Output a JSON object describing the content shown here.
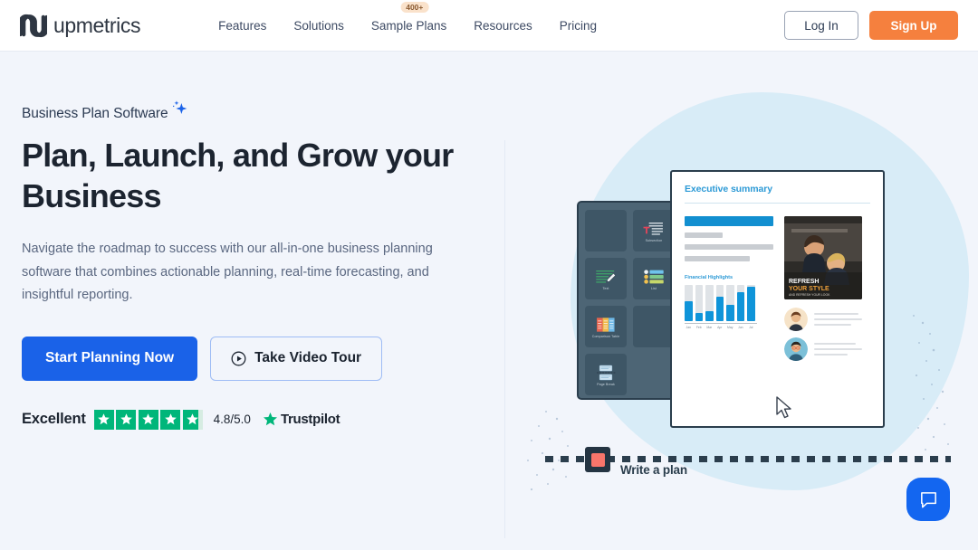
{
  "brand": {
    "name": "upmetrics",
    "logo_icon": "upmetrics-m-logo"
  },
  "nav": {
    "items": [
      {
        "label": "Features",
        "badge": null
      },
      {
        "label": "Solutions",
        "badge": null
      },
      {
        "label": "Sample Plans",
        "badge": "400+"
      },
      {
        "label": "Resources",
        "badge": null
      },
      {
        "label": "Pricing",
        "badge": null
      }
    ],
    "login_label": "Log In",
    "signup_label": "Sign Up"
  },
  "hero": {
    "eyebrow": "Business Plan Software",
    "eyebrow_icon": "sparkle-icon",
    "headline": "Plan, Launch, and Grow your Business",
    "subtext": "Navigate the roadmap to success with our all-in-one business planning software that combines actionable planning, real-time forecasting, and insightful reporting.",
    "primary_cta": "Start Planning Now",
    "secondary_cta": "Take Video Tour",
    "secondary_cta_icon": "play-circle-icon"
  },
  "trustpilot": {
    "rating_word": "Excellent",
    "score": "4.8/5.0",
    "brand": "Trustpilot",
    "stars_filled": 4,
    "stars_total": 5,
    "partial_fraction": 0.78,
    "star_color": "#00b67a",
    "brand_star_color": "#00b67a"
  },
  "illustration": {
    "document": {
      "title": "Executive summary",
      "photo_card": {
        "line1": "REFRESH",
        "line2": "YOUR STYLE",
        "line3": "AND REFRESH YOUR LOOK"
      }
    },
    "tool_panel": {
      "tiles": [
        {
          "label": "",
          "icon": "blank-tile"
        },
        {
          "label": "Subsection",
          "icon": "subsection-icon"
        },
        {
          "label": "Text",
          "icon": "text-icon"
        },
        {
          "label": "List",
          "icon": "list-icon"
        },
        {
          "label": "Comparison Table",
          "icon": "comparison-table-icon"
        },
        {
          "label": "",
          "icon": "blank-tile"
        },
        {
          "label": "Page Break",
          "icon": "page-break-icon"
        }
      ]
    },
    "write_a_plan": {
      "label": "Write a plan"
    },
    "cursor_icon": "arrow-cursor-icon"
  },
  "chart_data": {
    "type": "bar",
    "title": "Financial Highlights",
    "categories": [
      "Jan",
      "Feb",
      "Mar",
      "Apr",
      "May",
      "Jun",
      "Jul"
    ],
    "values": [
      55,
      22,
      28,
      68,
      45,
      80,
      95
    ],
    "ylim": [
      0,
      100
    ],
    "xlabel": "",
    "ylabel": "",
    "grid": false,
    "legend": null,
    "bar_color": "#0f94d9",
    "track_color": "#dfe3e7"
  },
  "chat_widget": {
    "icon": "chat-bubble-icon",
    "color": "#1366f0"
  },
  "colors": {
    "page_bg": "#f2f5fb",
    "header_bg": "#ffffff",
    "primary": "#1a62e8",
    "accent_orange": "#f5803e",
    "doc_accent": "#2d9ad6",
    "blob": "#d8ecf7",
    "panel_dark": "#4d6575"
  }
}
